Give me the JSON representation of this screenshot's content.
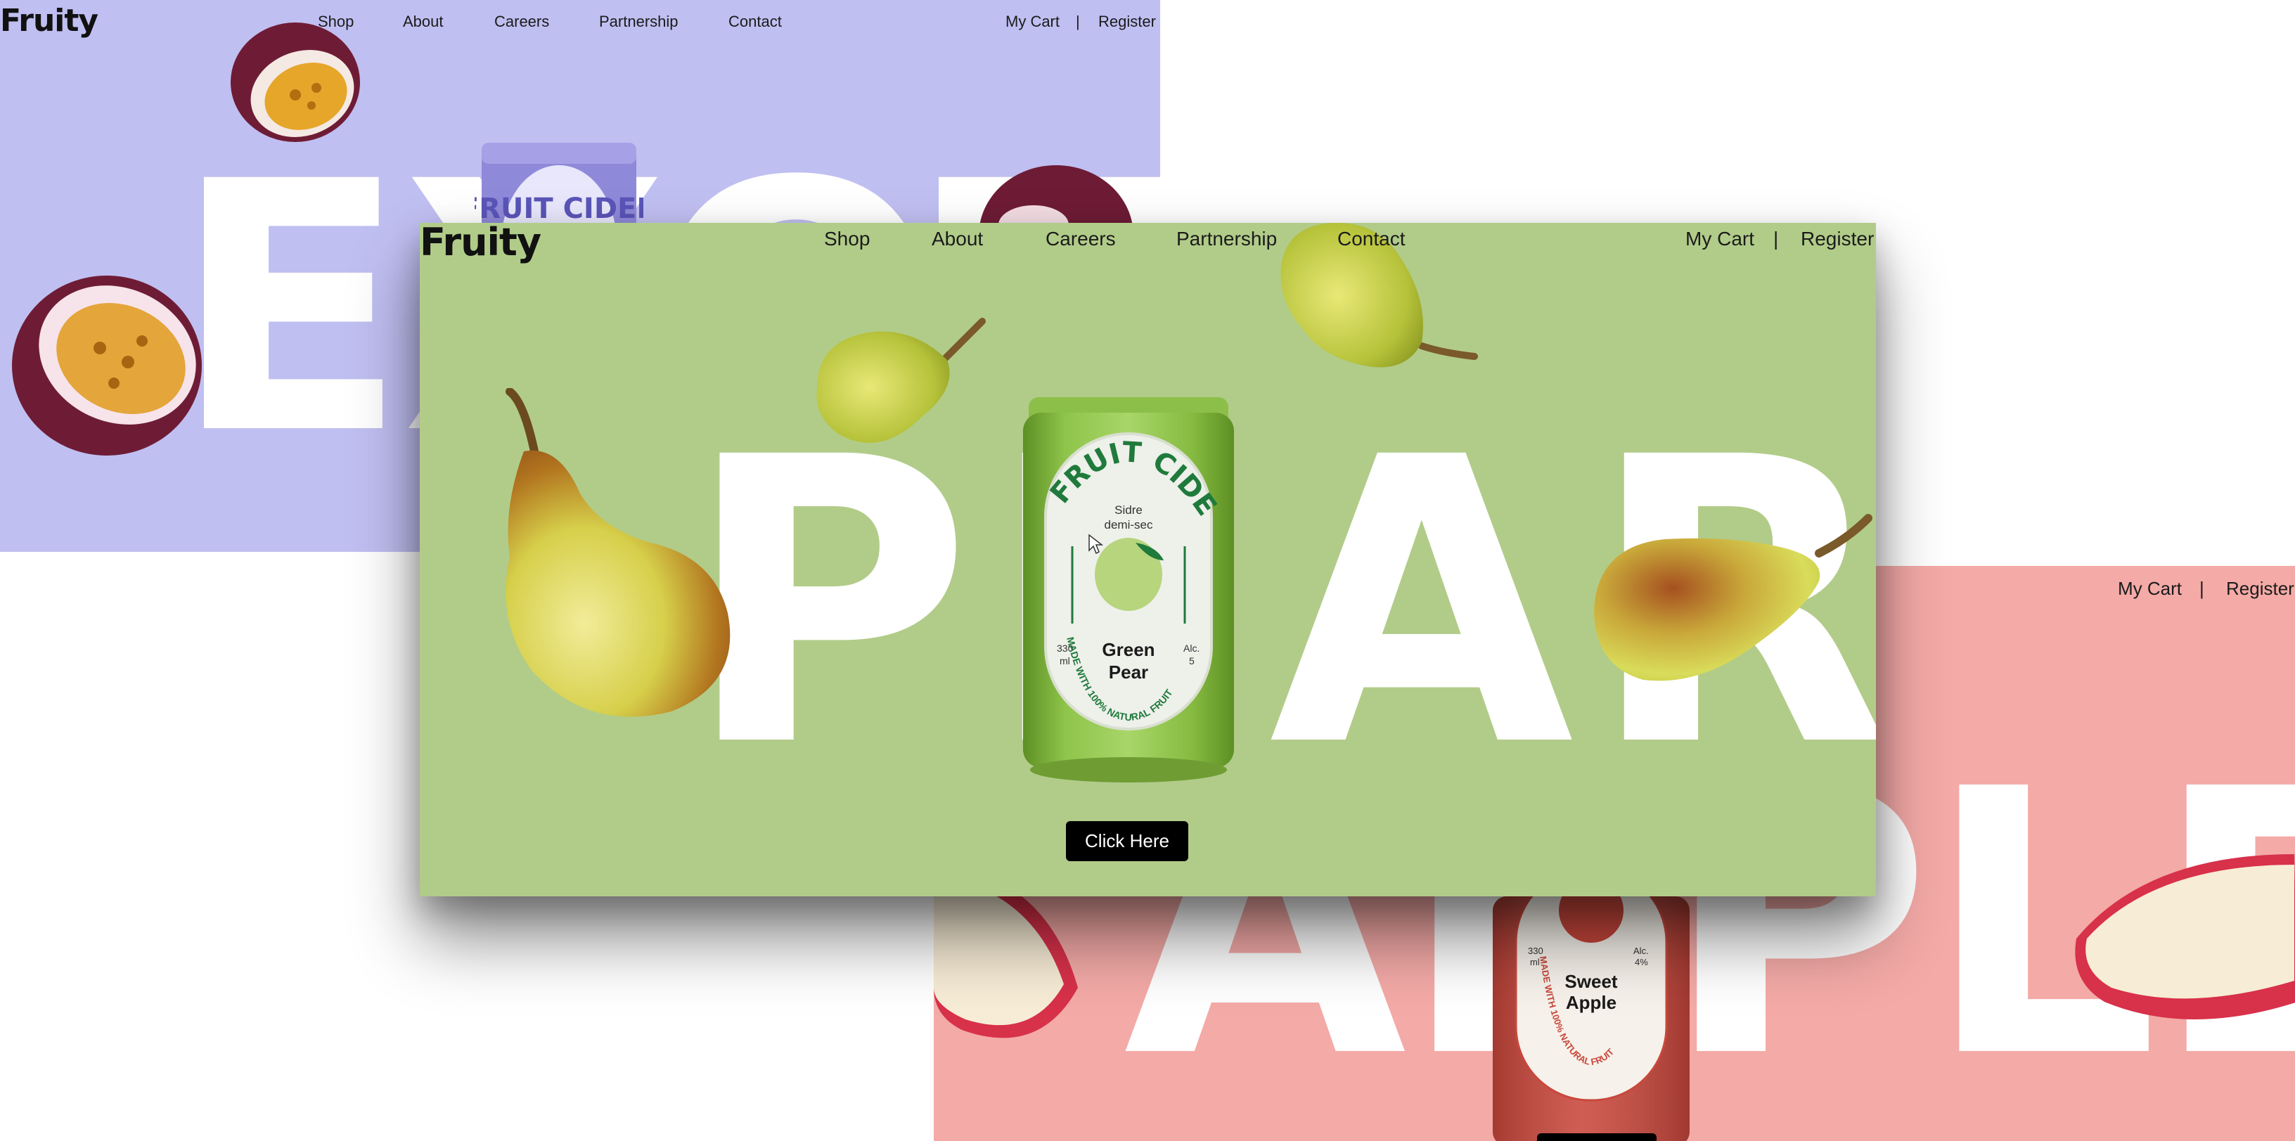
{
  "colors": {
    "exotic_bg": "#c0bff1",
    "pear_bg": "#b1cc89",
    "apple_bg": "#f4aaa7",
    "button_bg": "#000000",
    "can_green": "#7fb33a",
    "label_green": "#1f7a3c"
  },
  "exotic": {
    "logo": "Fruity",
    "nav": [
      "Shop",
      "About",
      "Careers",
      "Partnership",
      "Contact"
    ],
    "cart": "My Cart",
    "separator": "|",
    "register": "Register",
    "hero_word": "EXOTIC",
    "can_text": "FRUIT CIDER"
  },
  "pear": {
    "logo": "Fruity",
    "nav": [
      "Shop",
      "About",
      "Careers",
      "Partnership",
      "Contact"
    ],
    "cart": "My Cart",
    "separator": "|",
    "register": "Register",
    "hero_word": "PEAR",
    "can": {
      "brand": "FRUIT CIDER",
      "subtitle_line1": "Sidre",
      "subtitle_line2": "demi-sec",
      "flavor_line1": "Green",
      "flavor_line2": "Pear",
      "volume_line1": "330",
      "volume_line2": "ml",
      "alc_line1": "Alc.",
      "alc_line2": "5",
      "ring_text": "MADE WITH 100% NATURAL FRUIT"
    },
    "cta": "Click Here"
  },
  "apple": {
    "cart": "My Cart",
    "separator": "|",
    "register": "Register",
    "hero_word": "APPLE",
    "can": {
      "flavor_line1": "Sweet",
      "flavor_line2": "Apple",
      "volume_line1": "330",
      "volume_line2": "ml",
      "alc_line1": "Alc.",
      "alc_line2": "4%",
      "ring_text": "MADE WITH 100% NATURAL FRUIT"
    }
  }
}
